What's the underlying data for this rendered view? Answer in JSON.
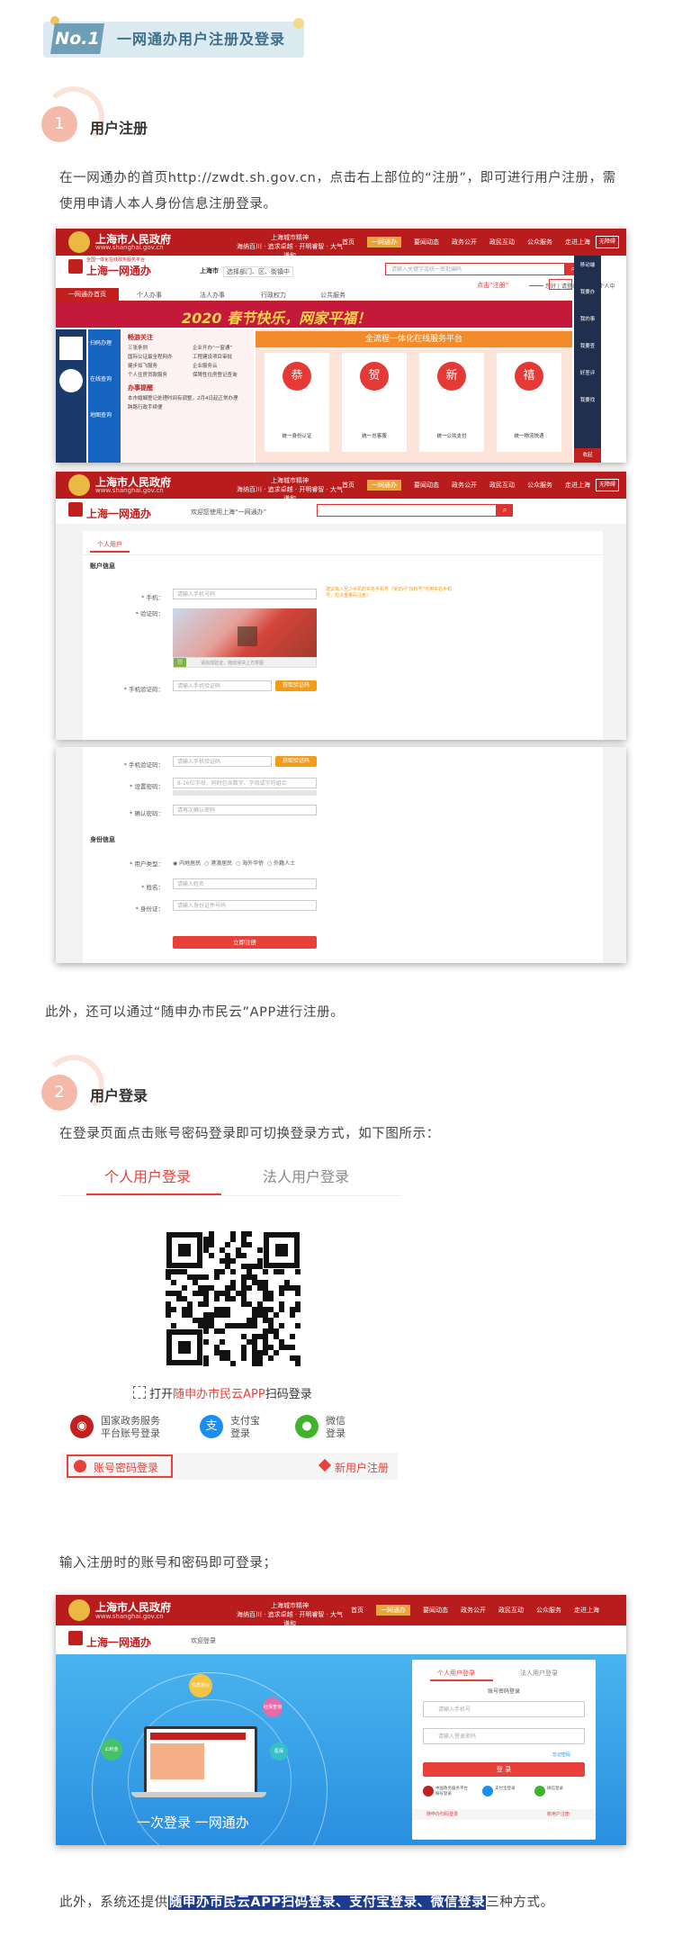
{
  "section": {
    "number": "No.1",
    "title": "一网通办用户注册及登录"
  },
  "step1": {
    "num": "1",
    "title": "用户注册",
    "para": "在一网通办的首页http://zwdt.sh.gov.cn，点击右上部位的“注册”，即可进行用户注册，需使用申请人本人身份信息注册登录。"
  },
  "shot1": {
    "gov_name": "上海市人民政府",
    "gov_url": "www.shanghai.gov.cn",
    "slogan": "上海城市精神",
    "slogan2": "海纳百川 · 追求卓越 · 开明睿智 · 大气谦和",
    "nav": [
      "首页",
      "一网通办",
      "要闻动态",
      "政务公开",
      "政民互动",
      "公众服务",
      "走进上海"
    ],
    "search_btn": "无障碍",
    "ywtb": "上海一网通办",
    "ywtb_tag": "全国一体化在线政务服务平台",
    "city": "上海市",
    "dept_select": "选择部门、区、街镇中",
    "search_ph": "请输入关键字或统一审批编码",
    "click_hint": "点击“注册”",
    "top_links": "您好 | 请登录 | 注册 | 个人中",
    "menu": [
      "一网通办首页",
      "个人办事",
      "法人办事",
      "行政权力",
      "公共服务"
    ],
    "banner": "2020 春节快乐，网家平福！",
    "platform": "全流程一体化在线服务平台",
    "left_menu": [
      "扫码办理",
      "在线查询",
      "地图查询"
    ],
    "hot_title": "畅游关注",
    "hot_items": [
      "三张条例",
      "国际公证最全程网办",
      "健步如飞服务",
      "个人住房贷款服务",
      "企业开办“一窗通”",
      "工程建设项目审批",
      "企业服务云",
      "保障性住房登记查询"
    ],
    "notice_title": "办事提醒",
    "notice_items": [
      "本市婚姻登记处理时间有调整，2月4日起正常办理",
      "跨路行政手续便"
    ],
    "cards": [
      "统一身份认证",
      "统一总客服",
      "统一公共支付",
      "统一物流快递"
    ],
    "card_chars": [
      "恭",
      "贺",
      "新",
      "禧"
    ],
    "side": [
      "移动端",
      "我要办",
      "我的事",
      "我要查",
      "好差评",
      "我要找",
      "收起"
    ]
  },
  "shot2": {
    "welcome": "欢迎您使用上海“一网通办”",
    "tab": "个人用户",
    "account_title": "账户信息",
    "phone_label": "* 手机：",
    "phone_ph": "请输入手机号码",
    "phone_tip": "建议输入至少手机的实名手机号（受访问“授权号”可用实名手机号，短次重量码注册）",
    "captcha_label": "* 验证码：",
    "captcha_tip": "请完成验证，拖动滑块上方拼图",
    "sms_label": "* 手机验证码：",
    "sms_ph": "请输入手机验证码",
    "sms_btn": "获取验证码"
  },
  "shot3": {
    "sms_label": "* 手机验证码：",
    "sms_ph": "请输入手机验证码",
    "sms_btn": "获取验证码",
    "pwd_label": "* 设置密码：",
    "pwd_ph": "8-16位字母，同时包含数字、字母或字符组合",
    "pwd2_label": "* 确认密码：",
    "pwd2_ph": "请再次确认密码",
    "id_title": "身份信息",
    "type_label": "* 用户类型：",
    "types": [
      "内地居民",
      "港澳居民",
      "海外华侨",
      "外籍人士"
    ],
    "name_label": "* 姓名：",
    "name_ph": "请输入姓名",
    "idcard_label": "* 身份证：",
    "idcard_ph": "请输入身份证件号码",
    "submit": "立即注册"
  },
  "para_app": "此外，还可以通过“随申办市民云”APP进行注册。",
  "step2": {
    "num": "2",
    "title": "用户登录",
    "para": "在登录页面点击账号密码登录即可切换登录方式，如下图所示："
  },
  "login": {
    "tab_personal": "个人用户登录",
    "tab_corp": "法人用户登录",
    "scan_pre": "打开",
    "scan_app": "随申办市民云APP",
    "scan_post": "扫码登录",
    "opts": [
      {
        "line1": "国家政务服务",
        "line2": "平台账号登录"
      },
      {
        "line1": "支付宝",
        "line2": "登录"
      },
      {
        "line1": "微信",
        "line2": "登录"
      }
    ],
    "account_login": "账号密码登录",
    "new_user": "新用户注册",
    "colors": {
      "red": "#e8413a",
      "alipay": "#1a8ef2",
      "wechat": "#3fb42a"
    }
  },
  "para_input": "输入注册时的账号和密码即可登录；",
  "shot4": {
    "welcome": "欢迎登录",
    "tab1": "个人用户登录",
    "tab2": "法人用户登录",
    "sub": "账号密码登录",
    "user_ph": "请输入手机号",
    "pwd_ph": "请输入登录密码",
    "forgot": "忘记密码",
    "login_btn": "登 录",
    "opts": [
      "中国政务服务平台账号登录",
      "支付宝登录",
      "微信登录"
    ],
    "scan": "随申办扫码登录",
    "new_user": "新用户注册",
    "slogan": "一次登录  一网通办",
    "bubbles": [
      "优质服务",
      "社保查询",
      "公积金",
      "医保"
    ]
  },
  "final": {
    "pre": "此外，系统还提供",
    "hl": "随申办市民云APP扫码登录、支付宝登录、微信登录",
    "post": "三种方式。"
  }
}
